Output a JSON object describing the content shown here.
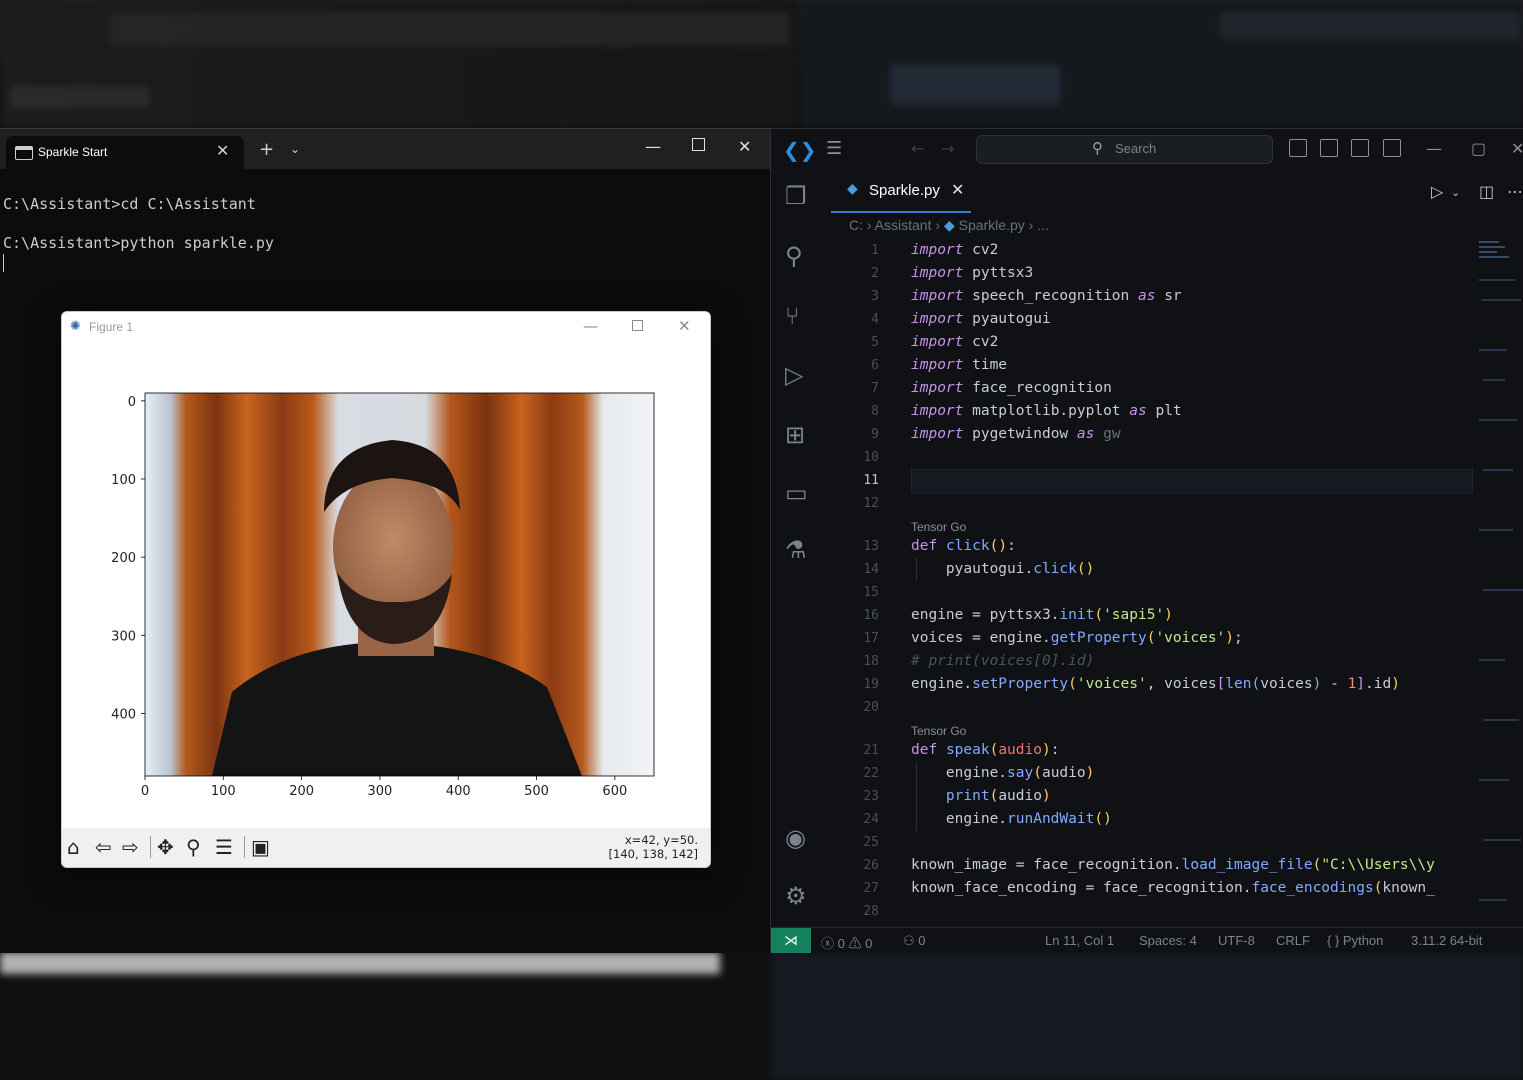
{
  "terminal": {
    "tab_label": "Sparkle Start",
    "lines": [
      "C:\\Assistant>cd C:\\Assistant",
      "",
      "C:\\Assistant>python sparkle.py"
    ]
  },
  "figure": {
    "title": "Figure 1",
    "coords_line1": "x=42, y=50.",
    "coords_line2": "[140, 138, 142]",
    "x_ticks": [
      "0",
      "100",
      "200",
      "300",
      "400",
      "500",
      "600"
    ],
    "y_ticks": [
      "0",
      "100",
      "200",
      "300",
      "400"
    ]
  },
  "vscode": {
    "search_placeholder": "Search",
    "tab_label": "Sparkle.py",
    "breadcrumb": {
      "root": "C:",
      "folder": "Assistant",
      "file": "Sparkle.py",
      "more": "..."
    },
    "codelens": "Tensor Go",
    "status": {
      "errors": "0",
      "warnings": "0",
      "ports": "0",
      "position": "Ln 11, Col 1",
      "spaces": "Spaces: 4",
      "encoding": "UTF-8",
      "eol": "CRLF",
      "language": "Python",
      "interpreter": "3.11.2 64-bit"
    }
  }
}
